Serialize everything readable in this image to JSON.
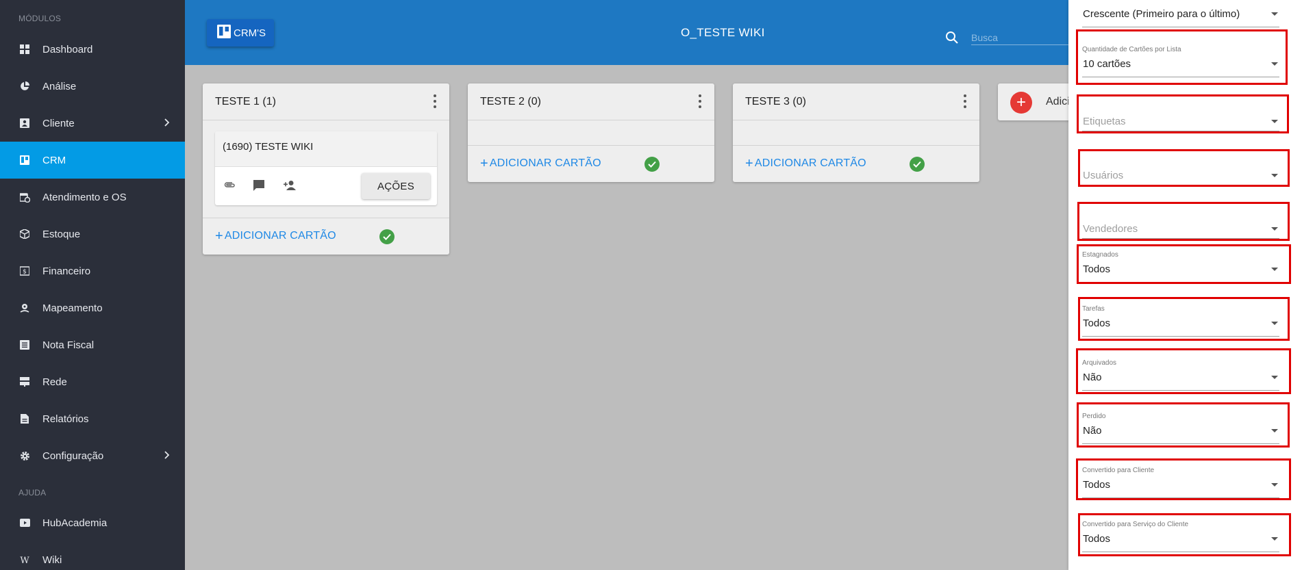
{
  "sidebar": {
    "section_modulos": "MÓDULOS",
    "section_ajuda": "AJUDA",
    "items": [
      {
        "label": "Dashboard",
        "icon": "grid-icon"
      },
      {
        "label": "Análise",
        "icon": "pie-chart-icon"
      },
      {
        "label": "Cliente",
        "icon": "contact-card-icon",
        "has_submenu": true
      },
      {
        "label": "CRM",
        "icon": "board-icon",
        "active": true
      },
      {
        "label": "Atendimento e OS",
        "icon": "clock-calendar-icon"
      },
      {
        "label": "Estoque",
        "icon": "box-icon"
      },
      {
        "label": "Financeiro",
        "icon": "money-icon"
      },
      {
        "label": "Mapeamento",
        "icon": "map-pin-icon"
      },
      {
        "label": "Nota Fiscal",
        "icon": "receipt-icon"
      },
      {
        "label": "Rede",
        "icon": "server-icon"
      },
      {
        "label": "Relatórios",
        "icon": "document-icon"
      },
      {
        "label": "Configuração",
        "icon": "gear-icon",
        "has_submenu": true
      }
    ],
    "help_items": [
      {
        "label": "HubAcademia",
        "icon": "video-icon"
      },
      {
        "label": "Wiki",
        "icon": "wikipedia-icon"
      }
    ]
  },
  "topbar": {
    "crms_label": "CRM'S",
    "board_title": "O_TESTE WIKI",
    "search_placeholder": "Busca"
  },
  "lists": [
    {
      "title": "TESTE 1",
      "count": "(1)",
      "cards": [
        {
          "title": "(1690) TESTE WIKI",
          "actions_label": "AÇÕES"
        }
      ],
      "add_card_label": "ADICIONAR CARTÃO"
    },
    {
      "title": "TESTE 2",
      "count": "(0)",
      "cards": [],
      "add_card_label": "ADICIONAR CARTÃO"
    },
    {
      "title": "TESTE 3",
      "count": "(0)",
      "cards": [],
      "add_card_label": "ADICIONAR CARTÃO"
    }
  ],
  "add_list_label": "Adicionar",
  "filters": {
    "order": {
      "value": "Crescente (Primeiro para o último)"
    },
    "cards_per_list": {
      "label": "Quantidade de Cartões por Lista",
      "value": "10 cartões"
    },
    "etiquetas": {
      "placeholder": "Etiquetas"
    },
    "usuarios": {
      "placeholder": "Usuários"
    },
    "vendedores": {
      "placeholder": "Vendedores"
    },
    "estagnados": {
      "label": "Estagnados",
      "value": "Todos"
    },
    "tarefas": {
      "label": "Tarefas",
      "value": "Todos"
    },
    "arquivados": {
      "label": "Arquivados",
      "value": "Não"
    },
    "perdido": {
      "label": "Perdido",
      "value": "Não"
    },
    "convertido_cliente": {
      "label": "Convertido para Cliente",
      "value": "Todos"
    },
    "convertido_servico": {
      "label": "Convertido para Serviço do Cliente",
      "value": "Todos"
    }
  },
  "colors": {
    "sidebar_bg": "#2b2f3a",
    "active_item": "#039be5",
    "topbar": "#1e78c2",
    "add_card_text": "#1e88e5",
    "check_green": "#43a047",
    "fab_red": "#e53935",
    "highlight_red": "#e00000"
  }
}
